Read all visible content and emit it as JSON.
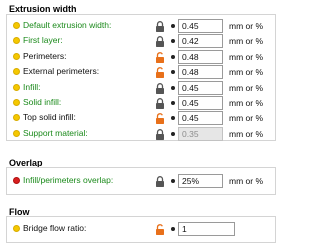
{
  "sections": {
    "extrusion_width": {
      "title": "Extrusion width",
      "rows": [
        {
          "label": "Default extrusion width:",
          "value": "0.45",
          "unit": "mm or %",
          "lock": "locked",
          "bullet": "yellow",
          "label_color": "green",
          "enabled": true
        },
        {
          "label": "First layer:",
          "value": "0.42",
          "unit": "mm or %",
          "lock": "locked",
          "bullet": "yellow",
          "label_color": "green",
          "enabled": true
        },
        {
          "label": "Perimeters:",
          "value": "0.48",
          "unit": "mm or %",
          "lock": "unlocked",
          "bullet": "yellow",
          "label_color": "black",
          "enabled": true
        },
        {
          "label": "External perimeters:",
          "value": "0.48",
          "unit": "mm or %",
          "lock": "unlocked",
          "bullet": "yellow",
          "label_color": "black",
          "enabled": true
        },
        {
          "label": "Infill:",
          "value": "0.45",
          "unit": "mm or %",
          "lock": "locked",
          "bullet": "yellow",
          "label_color": "green",
          "enabled": true
        },
        {
          "label": "Solid infill:",
          "value": "0.45",
          "unit": "mm or %",
          "lock": "locked",
          "bullet": "yellow",
          "label_color": "green",
          "enabled": true
        },
        {
          "label": "Top solid infill:",
          "value": "0.45",
          "unit": "mm or %",
          "lock": "unlocked",
          "bullet": "yellow",
          "label_color": "black",
          "enabled": true
        },
        {
          "label": "Support material:",
          "value": "0.35",
          "unit": "mm or %",
          "lock": "locked",
          "bullet": "yellow",
          "label_color": "green",
          "enabled": false
        }
      ]
    },
    "overlap": {
      "title": "Overlap",
      "rows": [
        {
          "label": "Infill/perimeters overlap:",
          "value": "25%",
          "unit": "mm or %",
          "lock": "locked",
          "bullet": "red",
          "label_color": "green",
          "enabled": true
        }
      ]
    },
    "flow": {
      "title": "Flow",
      "rows": [
        {
          "label": "Bridge flow ratio:",
          "value": "1",
          "unit": "",
          "lock": "unlocked",
          "bullet": "yellow",
          "label_color": "black",
          "enabled": true
        }
      ]
    }
  },
  "colors": {
    "label_modified_green": "#1b8a1b",
    "lock_locked": "#555555",
    "lock_unlocked": "#e8701a",
    "bullet_yellow": "#f5c800",
    "bullet_red": "#d81e1e"
  }
}
